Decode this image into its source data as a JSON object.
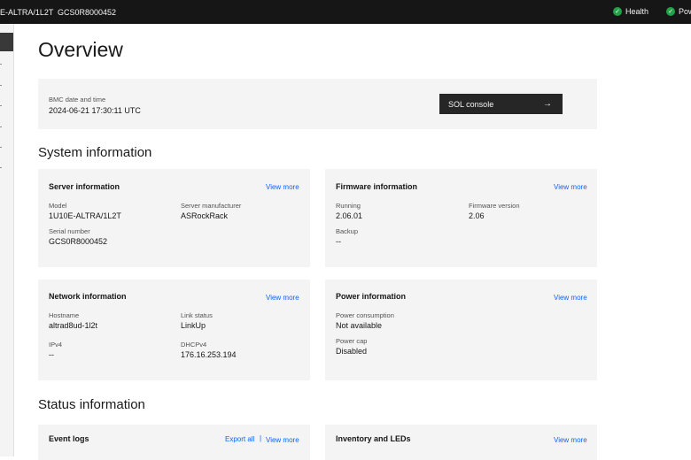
{
  "header": {
    "model": "E-ALTRA/1L2T",
    "serial": "GCS0R8000452",
    "health_label": "Health",
    "power_label": "Pow"
  },
  "page": {
    "title": "Overview"
  },
  "bmc": {
    "label": "BMC date and time",
    "value": "2024-06-21 17:30:11 UTC",
    "sol_label": "SOL console",
    "sol_arrow": "→"
  },
  "sections": {
    "system": "System information",
    "status": "Status information"
  },
  "server": {
    "title": "Server information",
    "view_more": "View more",
    "model_label": "Model",
    "model_value": "1U10E-ALTRA/1L2T",
    "manufacturer_label": "Server manufacturer",
    "manufacturer_value": "ASRockRack",
    "serial_label": "Serial number",
    "serial_value": "GCS0R8000452"
  },
  "firmware": {
    "title": "Firmware information",
    "view_more": "View more",
    "running_label": "Running",
    "running_value": "2.06.01",
    "version_label": "Firmware version",
    "version_value": "2.06",
    "backup_label": "Backup",
    "backup_value": "--"
  },
  "network": {
    "title": "Network information",
    "view_more": "View more",
    "hostname_label": "Hostname",
    "hostname_value": "altrad8ud-1l2t",
    "link_label": "Link status",
    "link_value": "LinkUp",
    "ipv4_label": "IPv4",
    "ipv4_value": "--",
    "dhcp_label": "DHCPv4",
    "dhcp_value": "176.16.253.194"
  },
  "power": {
    "title": "Power information",
    "view_more": "View more",
    "consumption_label": "Power consumption",
    "consumption_value": "Not available",
    "cap_label": "Power cap",
    "cap_value": "Disabled"
  },
  "events": {
    "title": "Event logs",
    "export_all": "Export all",
    "separator": "|",
    "view_more": "View more"
  },
  "inventory": {
    "title": "Inventory and LEDs",
    "view_more": "View more"
  },
  "colors": {
    "accent": "#0f62fe",
    "ok": "#24a148",
    "header_bg": "#161616",
    "tile_bg": "#f4f4f4"
  }
}
